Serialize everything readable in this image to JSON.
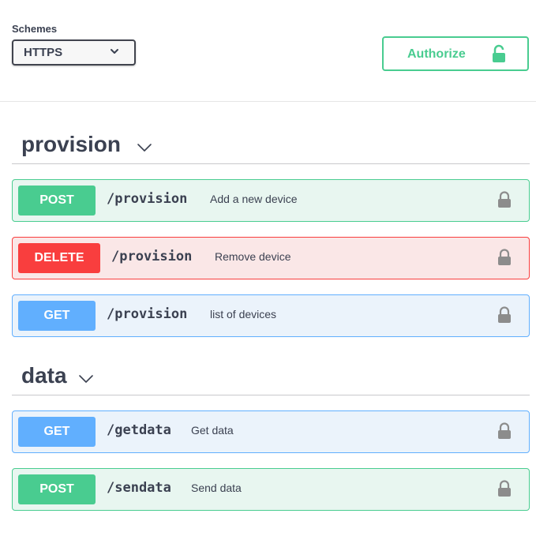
{
  "schemes": {
    "title": "Schemes",
    "selected": "HTTPS"
  },
  "authorize": {
    "label": "Authorize",
    "icon": "lock-open-icon",
    "color": "#49cc90"
  },
  "tags": [
    {
      "name": "provision",
      "operations": [
        {
          "method": "POST",
          "path": "/provision",
          "summary": "Add a new device",
          "color": "#49cc90"
        },
        {
          "method": "DELETE",
          "path": "/provision",
          "summary": "Remove device",
          "color": "#f93e3e"
        },
        {
          "method": "GET",
          "path": "/provision",
          "summary": "list of devices",
          "color": "#61affe"
        }
      ]
    },
    {
      "name": "data",
      "operations": [
        {
          "method": "GET",
          "path": "/getdata",
          "summary": "Get data",
          "color": "#61affe"
        },
        {
          "method": "POST",
          "path": "/sendata",
          "summary": "Send data",
          "color": "#49cc90"
        }
      ]
    }
  ],
  "icons": {
    "op_lock": "lock-icon",
    "tag_toggle": "chevron-down-icon"
  }
}
